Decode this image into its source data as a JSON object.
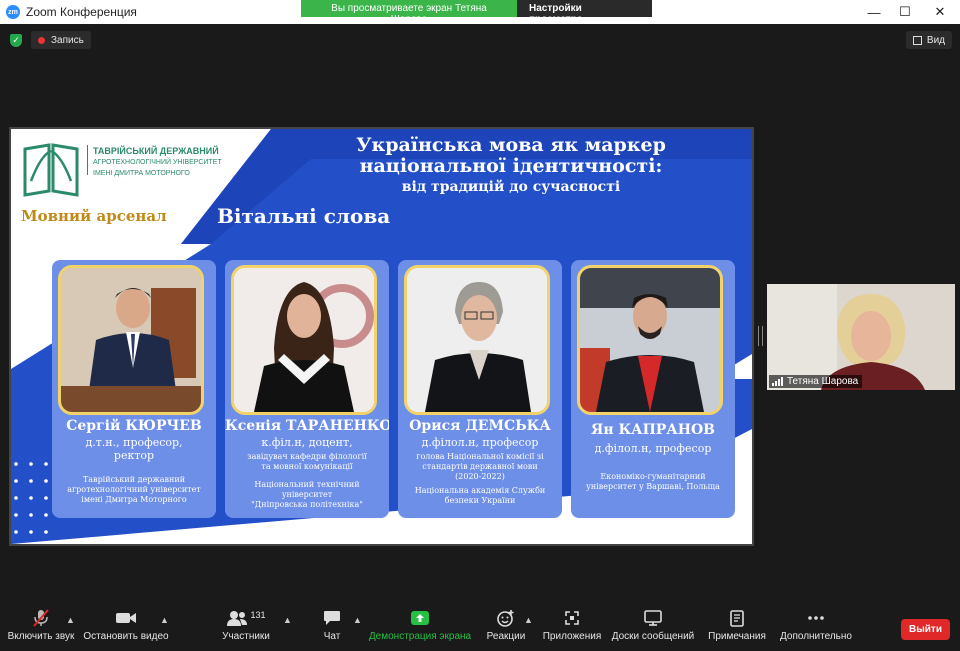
{
  "window": {
    "title": "Zoom Конференция",
    "logo_text": "zm",
    "share_banner": "Вы просматриваете экран Тетяна Шарова",
    "view_settings": "Настройки просмотра"
  },
  "top": {
    "record_label": "Запись",
    "view_label": "Вид"
  },
  "slide": {
    "university_line1": "ТАВРІЙСЬКИЙ ДЕРЖАВНИЙ",
    "university_line2": "АГРОТЕХНОЛОГІЧНИЙ УНІВЕРСИТЕТ",
    "university_line3": "ІМЕНІ ДМИТРА МОТОРНОГО",
    "brand": "Мовний арсенал",
    "title_line1": "Українська мова як маркер",
    "title_line2": "національної ідентичності:",
    "subtitle": "від традицій до сучасності",
    "section": "Вітальні слова",
    "speakers": [
      {
        "name": "Сергій КЮРЧЕВ",
        "role1": "д.т.н., професор,",
        "role2": "ректор",
        "desc1": "Таврійський державний",
        "desc2": "агротехнологічний університет",
        "desc3": "імені Дмитра Моторного",
        "desc4": ""
      },
      {
        "name": "Ксенія ТАРАНЕНКО",
        "role1": "к.філ.н, доцент,",
        "role2": "",
        "desc1": "завідувач кафедри філології",
        "desc2": "та мовної комунікації",
        "desc3": "Національний технічний університет",
        "desc4": "\"Дніпровська політехніка\""
      },
      {
        "name": "Орися ДЕМСЬКА",
        "role1": "д.філол.н, професор",
        "role2": "",
        "desc1": "голова Національної комісії зі",
        "desc2": "стандартів державної мови",
        "desc3": "(2020-2022)",
        "desc4": "Національна академія Служби безпеки України"
      },
      {
        "name": "Ян КАПРАНОВ",
        "role1": "д.філол.н, професор",
        "role2": "",
        "desc1": "Економіко-гуманітарний",
        "desc2": "університет у Варшаві, Польща",
        "desc3": "",
        "desc4": ""
      }
    ]
  },
  "participant": {
    "name": "Тетяна Шарова"
  },
  "toolbar": {
    "unmute": "Включить звук",
    "stop_video": "Остановить видео",
    "participants": "Участники",
    "participants_count": "131",
    "chat": "Чат",
    "share_screen": "Демонстрация экрана",
    "reactions": "Реакции",
    "apps": "Приложения",
    "whiteboards": "Доски сообщений",
    "notes": "Примечания",
    "more": "Дополнительно",
    "leave": "Выйти"
  },
  "colors": {
    "share_green": "#3bb54a",
    "slide_blue": "#2350c8",
    "card_blue": "#6e8fe8",
    "accent_gold": "#c08a18",
    "leave_red": "#e02828"
  }
}
